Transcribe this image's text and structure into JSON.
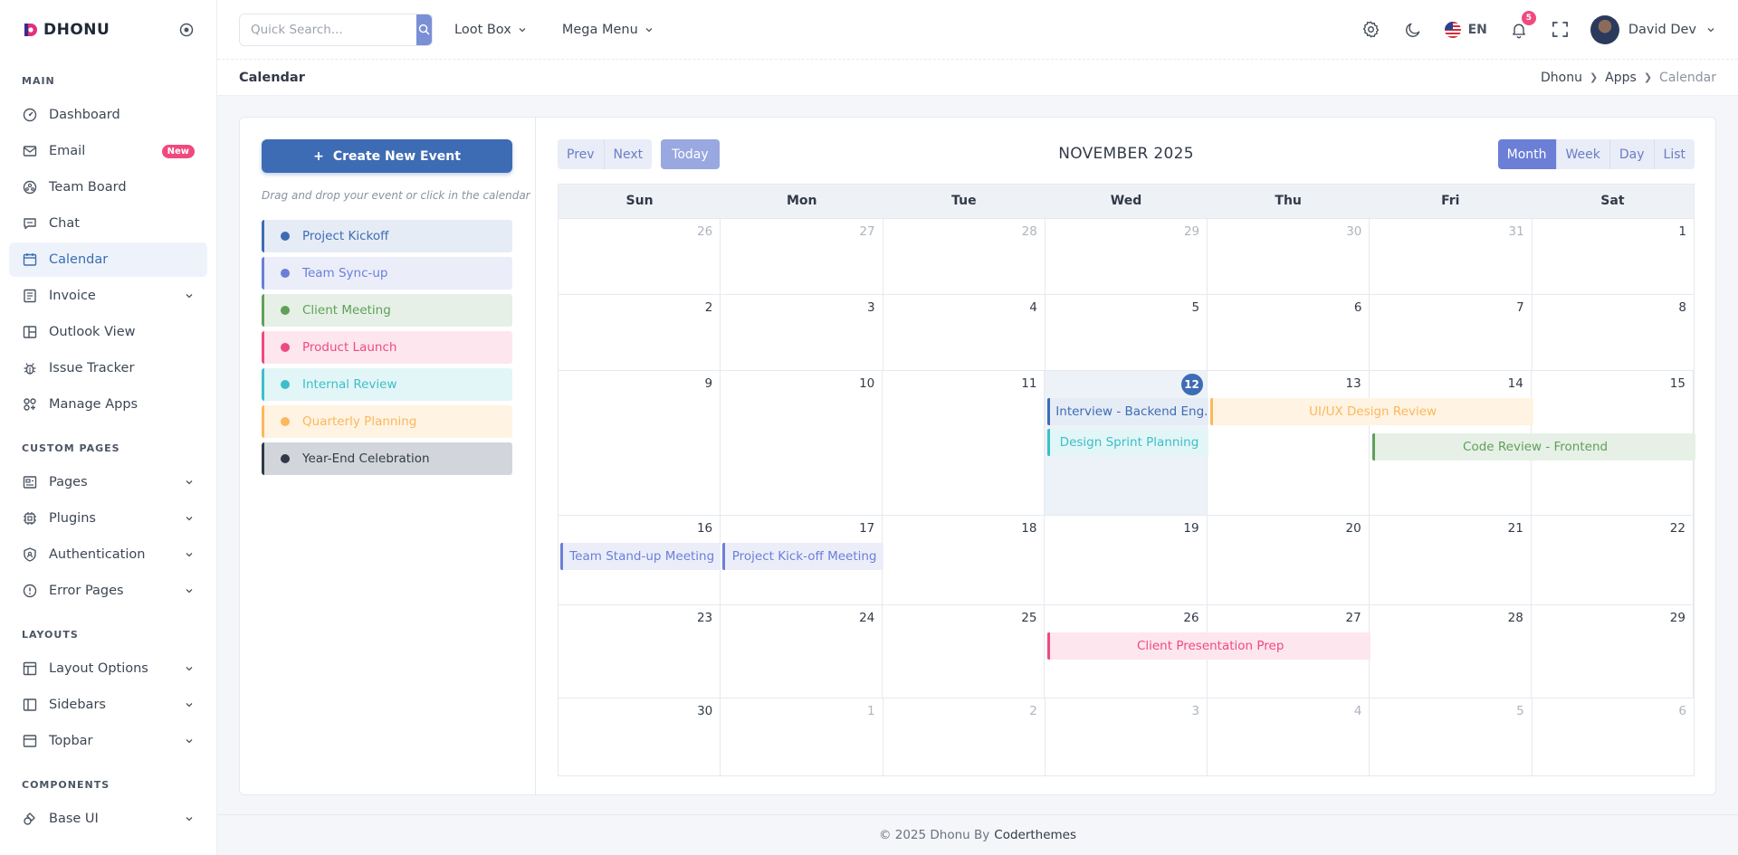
{
  "brand": {
    "name": "DHONU"
  },
  "sidebar": {
    "sections": [
      {
        "title": "MAIN",
        "items": [
          {
            "label": "Dashboard",
            "icon": "dashboard-icon"
          },
          {
            "label": "Email",
            "icon": "email-icon",
            "badge": "New"
          },
          {
            "label": "Team Board",
            "icon": "team-board-icon"
          },
          {
            "label": "Chat",
            "icon": "chat-icon"
          },
          {
            "label": "Calendar",
            "icon": "calendar-icon",
            "active": true
          },
          {
            "label": "Invoice",
            "icon": "invoice-icon",
            "chevron": true
          },
          {
            "label": "Outlook View",
            "icon": "outlook-icon"
          },
          {
            "label": "Issue Tracker",
            "icon": "bug-icon"
          },
          {
            "label": "Manage Apps",
            "icon": "apps-icon"
          }
        ]
      },
      {
        "title": "CUSTOM PAGES",
        "items": [
          {
            "label": "Pages",
            "icon": "pages-icon",
            "chevron": true
          },
          {
            "label": "Plugins",
            "icon": "plugins-icon",
            "chevron": true
          },
          {
            "label": "Authentication",
            "icon": "shield-icon",
            "chevron": true
          },
          {
            "label": "Error Pages",
            "icon": "error-icon",
            "chevron": true
          }
        ]
      },
      {
        "title": "LAYOUTS",
        "items": [
          {
            "label": "Layout Options",
            "icon": "layout-icon",
            "chevron": true
          },
          {
            "label": "Sidebars",
            "icon": "sidebar-icon",
            "chevron": true
          },
          {
            "label": "Topbar",
            "icon": "topbar-icon",
            "chevron": true
          }
        ]
      },
      {
        "title": "COMPONENTS",
        "items": [
          {
            "label": "Base UI",
            "icon": "base-ui-icon",
            "chevron": true
          }
        ]
      }
    ]
  },
  "topbar": {
    "search_placeholder": "Quick Search...",
    "menus": [
      "Loot Box",
      "Mega Menu"
    ],
    "language": "EN",
    "notification_count": "5",
    "user_name": "David Dev"
  },
  "titlebar": {
    "title": "Calendar",
    "breadcrumb": [
      "Dhonu",
      "Apps",
      "Calendar"
    ]
  },
  "left_panel": {
    "create_label": "Create New Event",
    "hint": "Drag and drop your event or click in the calendar",
    "events": [
      {
        "label": "Project Kickoff",
        "color": "#3e6cb4",
        "bg": "#e6ecf5"
      },
      {
        "label": "Team Sync-up",
        "color": "#6b7fd7",
        "bg": "#ebeef9"
      },
      {
        "label": "Client Meeting",
        "color": "#5fa05a",
        "bg": "#e6f0e6"
      },
      {
        "label": "Product Launch",
        "color": "#ef4a7f",
        "bg": "#fde6ee"
      },
      {
        "label": "Internal Review",
        "color": "#3dbec8",
        "bg": "#e2f6f7"
      },
      {
        "label": "Quarterly Planning",
        "color": "#fbb85c",
        "bg": "#fff3e3"
      },
      {
        "label": "Year-End Celebration",
        "color": "#313a46",
        "bg": "#d2d6dc"
      }
    ]
  },
  "calendar": {
    "title": "NOVEMBER 2025",
    "nav": {
      "prev": "Prev",
      "next": "Next",
      "today": "Today"
    },
    "views": [
      "Month",
      "Week",
      "Day",
      "List"
    ],
    "active_view": "Month",
    "weekdays": [
      "Sun",
      "Mon",
      "Tue",
      "Wed",
      "Thu",
      "Fri",
      "Sat"
    ],
    "weeks": [
      [
        "26",
        "27",
        "28",
        "29",
        "30",
        "31",
        "1"
      ],
      [
        "2",
        "3",
        "4",
        "5",
        "6",
        "7",
        "8"
      ],
      [
        "9",
        "10",
        "11",
        "12",
        "13",
        "14",
        "15"
      ],
      [
        "16",
        "17",
        "18",
        "19",
        "20",
        "21",
        "22"
      ],
      [
        "23",
        "24",
        "25",
        "26",
        "27",
        "28",
        "29"
      ],
      [
        "30",
        "1",
        "2",
        "3",
        "4",
        "5",
        "6"
      ]
    ],
    "today": "12",
    "events": [
      {
        "label": "Interview - Backend Eng...",
        "week": 2,
        "start": 3,
        "span": 1,
        "slot": 0,
        "color": "#3e6cb4",
        "bg": "#e6ecf5",
        "align": "left"
      },
      {
        "label": "UI/UX Design Review",
        "week": 2,
        "start": 4,
        "span": 2,
        "slot": 0,
        "color": "#fbb85c",
        "bg": "#fff3e3"
      },
      {
        "label": "Design Sprint Planning",
        "week": 2,
        "start": 3,
        "span": 1,
        "slot": 1,
        "color": "#3dbec8",
        "bg": "#e2f6f7"
      },
      {
        "label": "Code Review - Frontend",
        "week": 2,
        "start": 5,
        "span": 2,
        "slot": 1.15,
        "color": "#5fa05a",
        "bg": "#e6f0e6"
      },
      {
        "label": "Team Stand-up Meeting",
        "week": 3,
        "start": 0,
        "span": 1,
        "slot": 0,
        "color": "#6b7fd7",
        "bg": "#ebeef9"
      },
      {
        "label": "Project Kick-off Meeting",
        "week": 3,
        "start": 1,
        "span": 1,
        "slot": 0,
        "color": "#6b7fd7",
        "bg": "#ebeef9"
      },
      {
        "label": "Client Presentation Prep",
        "week": 4,
        "start": 3,
        "span": 2,
        "slot": 0,
        "color": "#ef4a7f",
        "bg": "#fde6ee"
      }
    ]
  },
  "footer": {
    "text": "© 2025 Dhonu By",
    "company": "Coderthemes"
  }
}
